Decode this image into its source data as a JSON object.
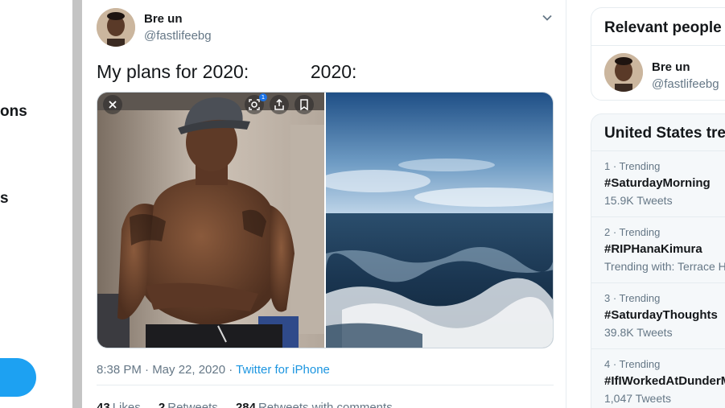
{
  "left_nav": {
    "fragment_1": "ons",
    "fragment_2": "s"
  },
  "tweet": {
    "author_name": "Bre un",
    "author_handle": "@fastlifeebg",
    "text": "My plans for 2020:            2020:",
    "timestamp": "8:38 PM · May 22, 2020 · ",
    "source": "Twitter for iPhone",
    "stats": {
      "likes_count": "43",
      "likes_label": "Likes",
      "retweets_count": "2",
      "retweets_label": "Retweets",
      "comments_count": "284",
      "comments_label": "Retweets with comments"
    },
    "lens_badge": "1"
  },
  "relevant_people": {
    "title": "Relevant people",
    "person": {
      "name": "Bre un",
      "handle": "@fastlifeebg"
    }
  },
  "trends": {
    "title": "United States trends",
    "items": [
      {
        "meta": "1 · Trending",
        "tag": "#SaturdayMorning",
        "sub": "15.9K Tweets"
      },
      {
        "meta": "2 · Trending",
        "tag": "#RIPHanaKimura",
        "sub": "Trending with: Terrace House"
      },
      {
        "meta": "3 · Trending",
        "tag": "#SaturdayThoughts",
        "sub": "39.8K Tweets"
      },
      {
        "meta": "4 · Trending",
        "tag": "#IfIWorkedAtDunderMifflin",
        "sub": "1,047 Tweets"
      }
    ]
  },
  "colors": {
    "accent": "#1da1f2",
    "link": "#1b95e0",
    "secondary_text": "#657786"
  },
  "icons": [
    "chevron-down-icon",
    "close-icon",
    "lens-icon",
    "share-icon",
    "bookmark-icon"
  ]
}
